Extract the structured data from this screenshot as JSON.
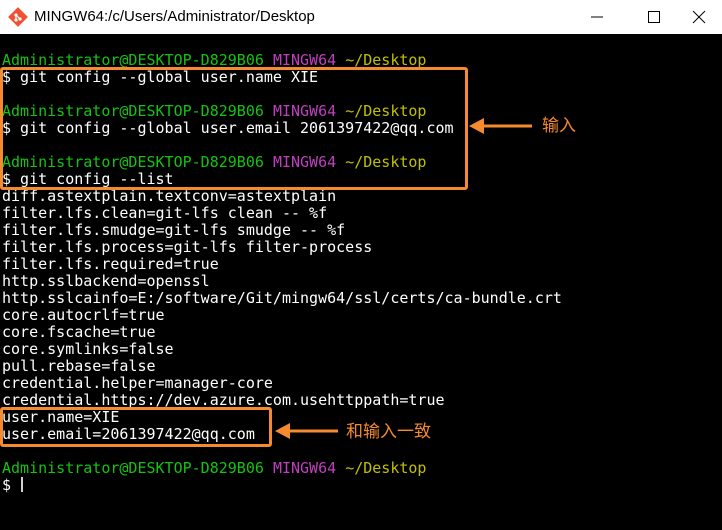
{
  "window": {
    "title": "MINGW64:/c/Users/Administrator/Desktop",
    "icon": "git-bash-icon",
    "controls": [
      "minimize-icon",
      "maximize-icon",
      "close-icon"
    ]
  },
  "prompt": {
    "user_host": "Administrator@DESKTOP-D829B06",
    "system": "MINGW64",
    "path": "~/Desktop",
    "symbol": "$"
  },
  "commands": [
    "$ git config --global user.name XIE",
    "$ git config --global user.email 2061397422@qq.com",
    "$ git config --list"
  ],
  "config_output": [
    "diff.astextplain.textconv=astextplain",
    "filter.lfs.clean=git-lfs clean -- %f",
    "filter.lfs.smudge=git-lfs smudge -- %f",
    "filter.lfs.process=git-lfs filter-process",
    "filter.lfs.required=true",
    "http.sslbackend=openssl",
    "http.sslcainfo=E:/software/Git/mingw64/ssl/certs/ca-bundle.crt",
    "core.autocrlf=true",
    "core.fscache=true",
    "core.symlinks=false",
    "pull.rebase=false",
    "credential.helper=manager-core",
    "credential.https://dev.azure.com.usehttppath=true",
    "user.name=XIE",
    "user.email=2061397422@qq.com"
  ],
  "final_prompt_symbol": "$",
  "annotations": {
    "input_label": "输入",
    "match_label": "和输入一致",
    "color": "#f58a2f"
  },
  "colors": {
    "background": "#000000",
    "text": "#ffffff",
    "user_host": "#13c40f",
    "system": "#bf3fbf",
    "path": "#c0c000"
  }
}
